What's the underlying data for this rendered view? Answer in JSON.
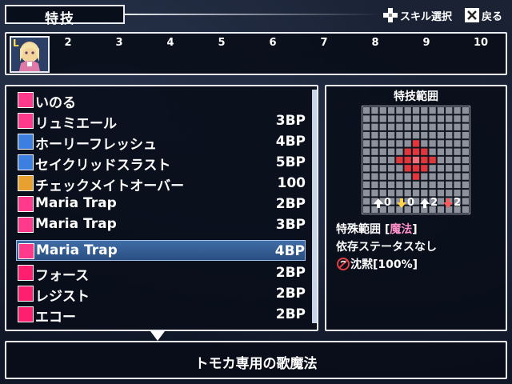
{
  "header": {
    "title": "特技",
    "hint_skill_select": "スキル選択",
    "hint_back": "戻る"
  },
  "party": {
    "leader_badge": "L",
    "slot_numbers": [
      "2",
      "3",
      "4",
      "5",
      "6",
      "7",
      "8",
      "9",
      "10"
    ]
  },
  "skills": [
    {
      "name": "いのる",
      "cost": "",
      "icon": "pray-icon",
      "color": "#ff3a8c"
    },
    {
      "name": "リュミエール",
      "cost": "3BP",
      "icon": "lumiere-icon",
      "color": "#ff3a8c"
    },
    {
      "name": "ホーリーフレッシュ",
      "cost": "4BP",
      "icon": "holy-flash-icon",
      "color": "#3c7fe0"
    },
    {
      "name": "セイクリッドスラスト",
      "cost": "5BP",
      "icon": "sacred-thrust-icon",
      "color": "#3c7fe0"
    },
    {
      "name": "チェックメイトオーバー",
      "cost": "100",
      "icon": "checkmate-icon",
      "color": "#e8a030"
    },
    {
      "name": "Maria Trap",
      "cost": "2BP",
      "icon": "music-note-icon",
      "color": "#ff3a8c"
    },
    {
      "name": "Maria Trap",
      "cost": "3BP",
      "icon": "music-note-plus1-icon",
      "color": "#ff3a8c"
    },
    {
      "name": "Maria Trap",
      "cost": "4BP",
      "icon": "music-note-plus2-icon",
      "color": "#ff3a8c",
      "selected": true
    },
    {
      "name": "フォース",
      "cost": "2BP",
      "icon": "vo-icon",
      "color": "#ff1f6e"
    },
    {
      "name": "レジスト",
      "cost": "2BP",
      "icon": "vo-icon",
      "color": "#ff1f6e"
    },
    {
      "name": "エコー",
      "cost": "2BP",
      "icon": "vo-icon",
      "color": "#ff1f6e"
    }
  ],
  "info": {
    "range_title": "特技範囲",
    "stats": [
      "0",
      "0",
      "2",
      "2"
    ],
    "special_range_label": "特殊範囲 [",
    "special_range_value": "魔法",
    "special_range_close": "]",
    "dependent_status": "依存ステータスなし",
    "effect": "沈黙[100%]"
  },
  "description": "トモカ専用の歌魔法",
  "colors": {
    "grid_highlight": "#e0363c",
    "grid_center": "#f0707a",
    "panel_border": "#e8ecf2",
    "selection": "#2f5a90"
  }
}
